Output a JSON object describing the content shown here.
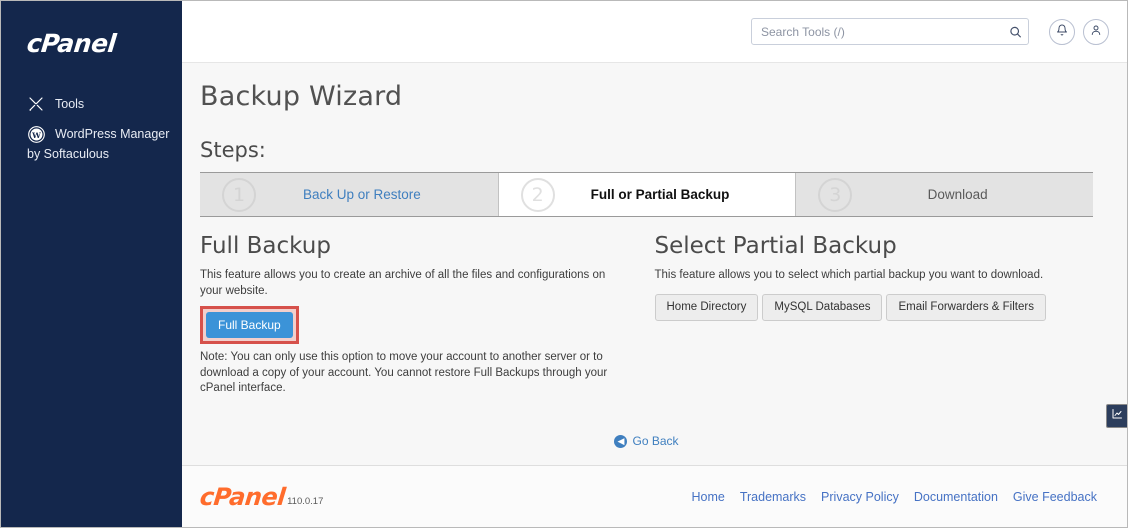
{
  "sidebar": {
    "brand": "cPanel",
    "items": [
      {
        "label": "Tools",
        "icon": "tools-icon"
      },
      {
        "label": "WordPress Manager",
        "icon": "wordpress-icon"
      }
    ],
    "sub_label": "by Softaculous"
  },
  "header": {
    "search_placeholder": "Search Tools (/)",
    "search_value": "",
    "search_icon": "search-icon",
    "notifications_icon": "bell-icon",
    "account_icon": "user-icon"
  },
  "main": {
    "page_title": "Backup Wizard",
    "steps_label": "Steps:",
    "steps": [
      {
        "number": "1",
        "label": "Back Up or Restore",
        "state": "done"
      },
      {
        "number": "2",
        "label": "Full or Partial Backup",
        "state": "active"
      },
      {
        "number": "3",
        "label": "Download",
        "state": "future"
      }
    ],
    "full_backup": {
      "heading": "Full Backup",
      "description": "This feature allows you to create an archive of all the files and configurations on your website.",
      "button_label": "Full Backup",
      "note": "Note: You can only use this option to move your account to another server or to download a copy of your account. You cannot restore Full Backups through your cPanel interface."
    },
    "partial_backup": {
      "heading": "Select Partial Backup",
      "description": "This feature allows you to select which partial backup you want to download.",
      "options": [
        "Home Directory",
        "MySQL Databases",
        "Email Forwarders & Filters"
      ]
    },
    "go_back_label": "Go Back",
    "go_back_icon": "arrow-left-circle-icon",
    "side_tab_icon": "chart-icon"
  },
  "footer": {
    "brand": "cPanel",
    "version": "110.0.17",
    "links": [
      "Home",
      "Trademarks",
      "Privacy Policy",
      "Documentation",
      "Give Feedback"
    ]
  },
  "colors": {
    "sidebar_bg": "#14274c",
    "primary_button": "#3b93d8",
    "highlight_border": "#d6514b",
    "link_blue": "#3f7fbf",
    "brand_orange": "#ff6c2c"
  }
}
